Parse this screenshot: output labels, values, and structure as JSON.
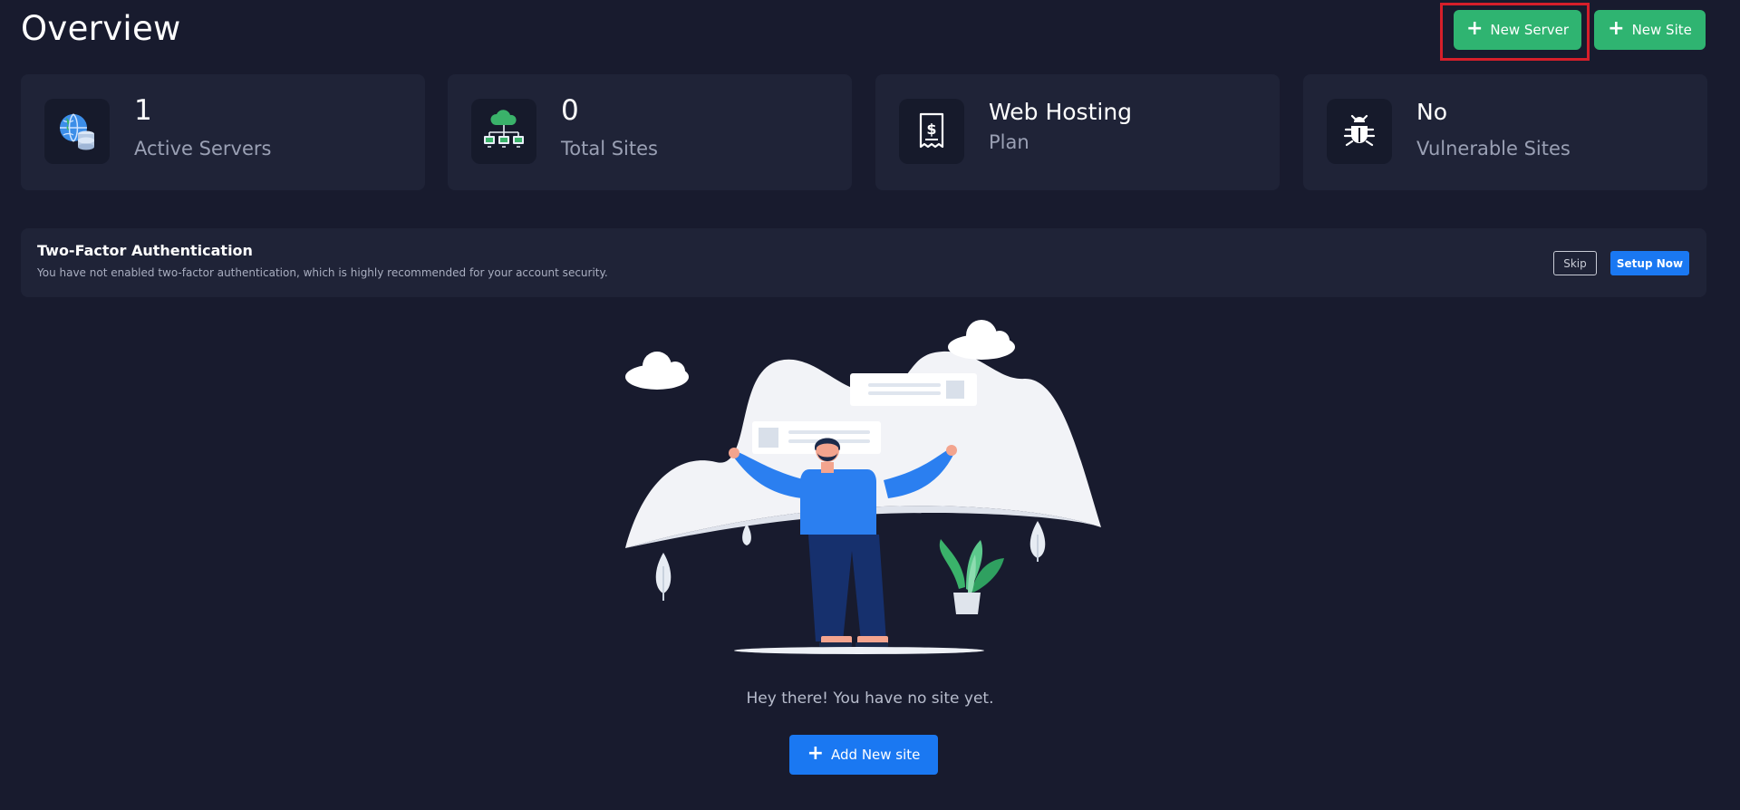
{
  "page": {
    "title": "Overview"
  },
  "header_actions": {
    "new_server": "New Server",
    "new_site": "New Site",
    "plus_glyph": "+"
  },
  "stats": [
    {
      "value": "1",
      "label": "Active Servers",
      "icon": "globe-database-icon"
    },
    {
      "value": "0",
      "label": "Total Sites",
      "icon": "cloud-network-icon"
    },
    {
      "value": "Web Hosting",
      "label": "Plan",
      "icon": "receipt-dollar-icon"
    },
    {
      "value": "No",
      "label": "Vulnerable Sites",
      "icon": "bug-icon"
    }
  ],
  "twofa": {
    "title": "Two-Factor Authentication",
    "description": "You have not enabled two-factor authentication, which is highly recommended for your account security.",
    "skip": "Skip",
    "setup": "Setup Now"
  },
  "empty_state": {
    "message": "Hey there! You have no site yet.",
    "add_button": "Add New site"
  },
  "colors": {
    "background": "#181b2e",
    "card": "#1f2337",
    "green": "#2fb471",
    "blue": "#1a78f2",
    "highlight": "#d61f2a"
  }
}
